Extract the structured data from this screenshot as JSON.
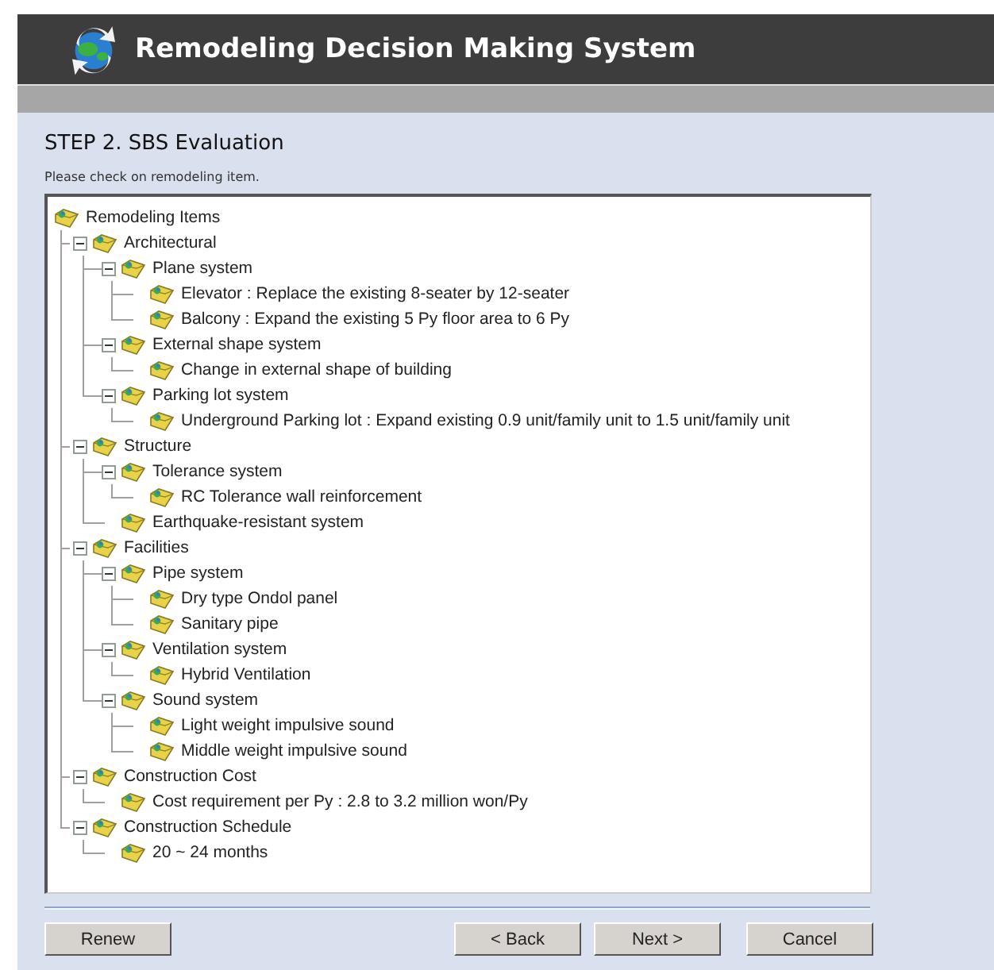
{
  "header": {
    "title": "Remodeling Decision Making System"
  },
  "step": {
    "title": "STEP 2. SBS Evaluation",
    "instruction": "Please check on remodeling item."
  },
  "tree": {
    "label": "Remodeling Items",
    "children": [
      {
        "label": "Architectural",
        "expanded": true,
        "children": [
          {
            "label": "Plane system",
            "expanded": true,
            "children": [
              {
                "label": "Elevator : Replace the existing 8-seater by 12-seater"
              },
              {
                "label": "Balcony : Expand the existing 5 Py floor area to 6 Py"
              }
            ]
          },
          {
            "label": "External shape system",
            "expanded": true,
            "children": [
              {
                "label": "Change in external shape of building"
              }
            ]
          },
          {
            "label": "Parking lot system",
            "expanded": true,
            "children": [
              {
                "label": "Underground Parking lot : Expand existing 0.9 unit/family unit to 1.5 unit/family unit"
              }
            ]
          }
        ]
      },
      {
        "label": "Structure",
        "expanded": true,
        "children": [
          {
            "label": "Tolerance system",
            "expanded": true,
            "children": [
              {
                "label": "RC Tolerance wall reinforcement"
              }
            ]
          },
          {
            "label": "Earthquake-resistant system"
          }
        ]
      },
      {
        "label": "Facilities",
        "expanded": true,
        "children": [
          {
            "label": "Pipe system",
            "expanded": true,
            "children": [
              {
                "label": "Dry type Ondol panel"
              },
              {
                "label": "Sanitary pipe"
              }
            ]
          },
          {
            "label": "Ventilation system",
            "expanded": true,
            "children": [
              {
                "label": "Hybrid Ventilation"
              }
            ]
          },
          {
            "label": "Sound system",
            "expanded": true,
            "children": [
              {
                "label": "Light weight impulsive sound"
              },
              {
                "label": "Middle weight impulsive sound"
              }
            ]
          }
        ]
      },
      {
        "label": "Construction Cost",
        "expanded": true,
        "children": [
          {
            "label": "Cost requirement per Py : 2.8 to 3.2 million won/Py"
          }
        ]
      },
      {
        "label": "Construction Schedule",
        "expanded": true,
        "children": [
          {
            "label": "20 ~ 24 months"
          }
        ]
      }
    ]
  },
  "buttons": [
    {
      "label": "Renew"
    },
    {
      "label": "< Back"
    },
    {
      "label": "Next >"
    },
    {
      "label": "Cancel"
    }
  ]
}
